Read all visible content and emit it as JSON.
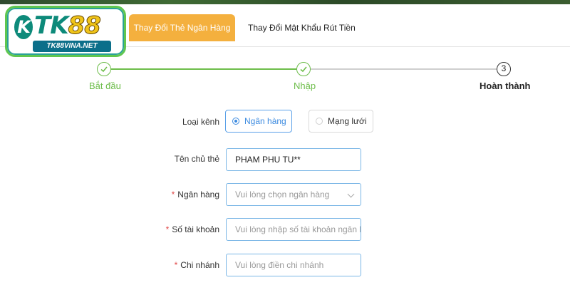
{
  "logo": {
    "main_k": "K",
    "main_tk": "TK",
    "main_88": "88",
    "sub": "TK88VINA.NET"
  },
  "tabs": [
    {
      "label": "Thay Đổi Thẻ Ngân Hàng",
      "active": true
    },
    {
      "label": "Thay Đổi Mật Khẩu Rút Tiền",
      "active": false
    }
  ],
  "stepper": {
    "steps": [
      {
        "label": "Bắt đầu",
        "state": "done",
        "icon": "check-icon"
      },
      {
        "label": "Nhập",
        "state": "done",
        "icon": "check-icon"
      },
      {
        "label": "Hoàn thành",
        "state": "current",
        "number": "3"
      }
    ]
  },
  "form": {
    "channel": {
      "label": "Loại kênh",
      "options": [
        {
          "label": "Ngân hàng",
          "checked": true
        },
        {
          "label": "Mạng lưới",
          "checked": false
        }
      ]
    },
    "holder": {
      "label": "Tên chủ thẻ",
      "value": "PHAM PHU TU**"
    },
    "bank": {
      "required_mark": "*",
      "label": "Ngân hàng",
      "placeholder": "Vui lòng chọn ngân hàng"
    },
    "account": {
      "required_mark": "*",
      "label": "Số tài khoản",
      "placeholder": "Vui lòng nhập số tài khoản ngân hà"
    },
    "branch": {
      "required_mark": "*",
      "label": "Chi nhánh",
      "placeholder": "Vui lòng điền chi nhánh"
    }
  },
  "colors": {
    "accent_tab": "#f4b03e",
    "step_done": "#6dbd4a",
    "input_border": "#7ab6e6",
    "radio_checked": "#3d8be0",
    "required": "#e04848"
  }
}
